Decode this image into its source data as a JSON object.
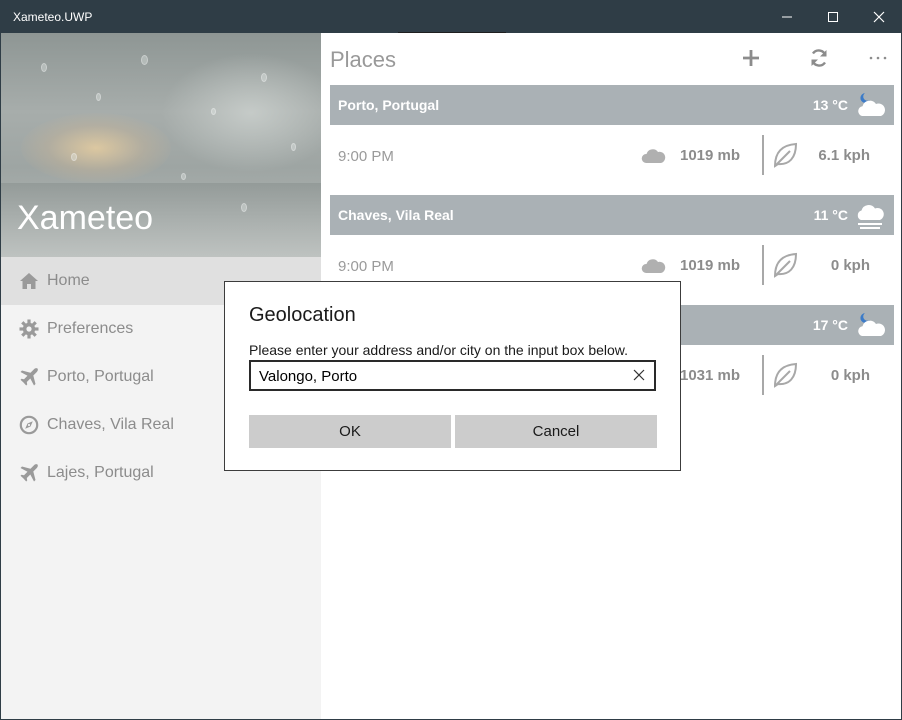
{
  "window": {
    "title": "Xameteo.UWP",
    "minimize_icon": "minimize-icon",
    "maximize_icon": "maximize-icon",
    "close_icon": "close-icon"
  },
  "sidebar": {
    "app_name": "Xameteo",
    "items": [
      {
        "label": "Home",
        "icon": "home-icon",
        "active": true
      },
      {
        "label": "Preferences",
        "icon": "gear-icon",
        "active": false
      },
      {
        "label": "Porto, Portugal",
        "icon": "airplane-icon",
        "active": false
      },
      {
        "label": "Chaves, Vila Real",
        "icon": "compass-icon",
        "active": false
      },
      {
        "label": "Lajes, Portugal",
        "icon": "airplane-icon",
        "active": false
      }
    ]
  },
  "main": {
    "title": "Places",
    "commands": [
      {
        "name": "add",
        "icon": "plus-icon"
      },
      {
        "name": "refresh",
        "icon": "refresh-icon"
      },
      {
        "name": "more",
        "icon": "more-icon"
      }
    ],
    "places": [
      {
        "name": "Porto, Portugal",
        "temperature": "13 °C",
        "weather_icon": "partly-cloudy-night-icon",
        "time": "9:00 PM",
        "pressure": "1019 mb",
        "wind": "6.1 kph"
      },
      {
        "name": "Chaves, Vila Real",
        "temperature": "11 °C",
        "weather_icon": "fog-icon",
        "time": "9:00 PM",
        "pressure": "1019 mb",
        "wind": "0 kph"
      },
      {
        "name": "",
        "temperature": "17 °C",
        "weather_icon": "partly-cloudy-night-icon",
        "time": "",
        "pressure": "1031 mb",
        "wind": "0 kph"
      }
    ]
  },
  "dialog": {
    "title": "Geolocation",
    "message": "Please enter your address and/or city on the input box below.",
    "input_value": "Valongo, Porto",
    "ok_label": "OK",
    "cancel_label": "Cancel"
  },
  "colors": {
    "title_bar": "#2f3d46",
    "place_header": "#aab1b5",
    "sidebar": "#f3f3f3",
    "dialog_button": "#cccccc"
  }
}
